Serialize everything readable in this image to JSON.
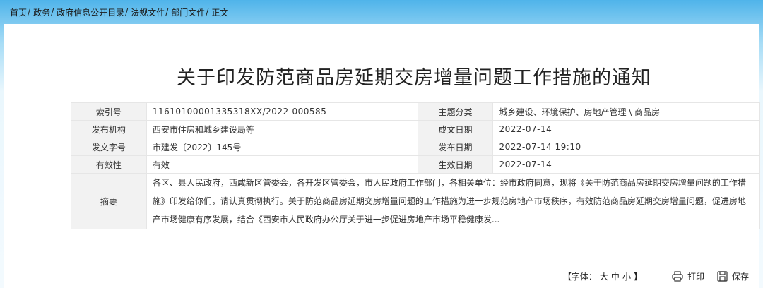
{
  "breadcrumb": {
    "items": [
      "首页",
      "政务",
      "政府信息公开目录",
      "法规文件",
      "部门文件"
    ],
    "separator": "/",
    "current": "正文"
  },
  "document": {
    "title": "关于印发防范商品房延期交房增量问题工作措施的通知"
  },
  "meta": {
    "index_label": "索引号",
    "index_value": "11610100001335318XX/2022-000585",
    "topic_label": "主题分类",
    "topic_value": "城乡建设、环境保护、房地产管理 \\ 商品房",
    "issuer_label": "发布机构",
    "issuer_value": "西安市住房和城乡建设局等",
    "created_label": "成文日期",
    "created_value": "2022-07-14",
    "docno_label": "发文字号",
    "docno_value": "市建发〔2022〕145号",
    "published_label": "发布日期",
    "published_value": "2022-07-14 19:10",
    "validity_label": "有效性",
    "validity_value": "有效",
    "effective_label": "生效日期",
    "effective_value": "2022-07-14",
    "summary_label": "摘要",
    "summary_value": "各区、县人民政府，西咸新区管委会，各开发区管委会，市人民政府工作部门，各相关单位：经市政府同意，现将《关于防范商品房延期交房增量问题的工作措施》印发给你们，请认真贯彻执行。关于防范商品房延期交房增量问题的工作措施为进一步规范房地产市场秩序，有效防范商品房延期交房增量问题，促进房地产市场健康有序发展，结合《西安市人民政府办公厅关于进一步促进房地产市场平稳健康发..."
  },
  "tools": {
    "font_prefix": "【字体：",
    "font_large": "大",
    "font_medium": "中",
    "font_small": "小",
    "font_suffix": "】",
    "print_label": "打印",
    "save_label": "保存",
    "print_icon": "printer-icon",
    "save_icon": "save-icon"
  },
  "colors": {
    "header_blue": "#4fb4ea",
    "label_bg": "#f2f2f2"
  }
}
